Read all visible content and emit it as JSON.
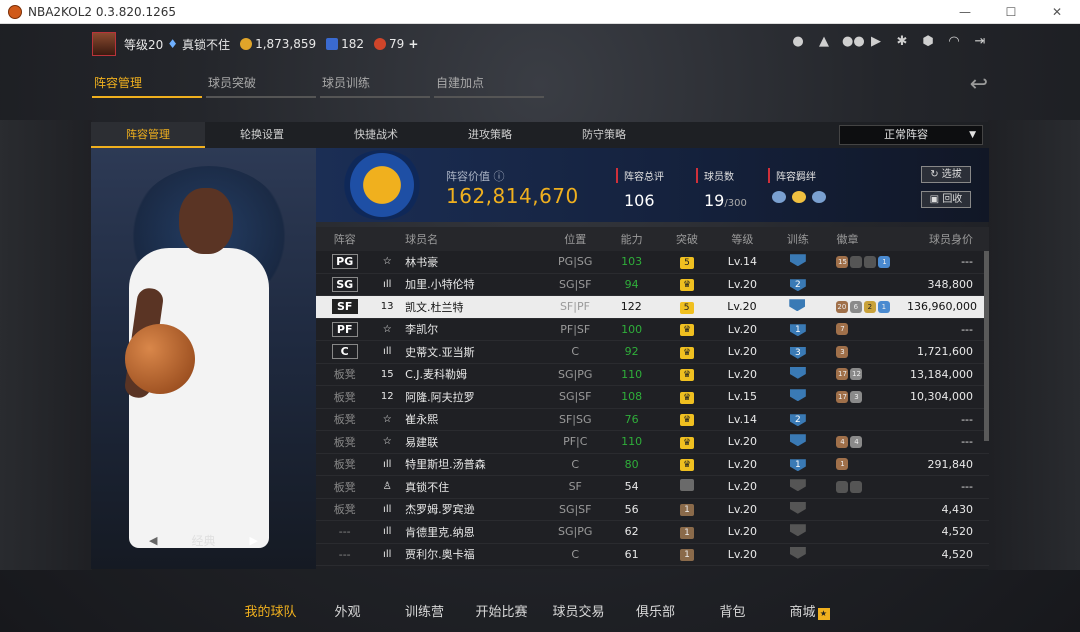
{
  "window": {
    "title": "NBA2KOL2 0.3.820.1265",
    "min_glyph": "—",
    "max_glyph": "☐",
    "close_glyph": "✕"
  },
  "user": {
    "level": "等级20",
    "name": "真锁不住",
    "coins": "1,873,859",
    "stars": "182",
    "points": "79",
    "add_glyph": "+"
  },
  "top_icons": [
    "person-icon",
    "bell-icon",
    "friends-icon",
    "video-icon",
    "gear-icon",
    "shield-icon",
    "headset-icon",
    "exit-icon"
  ],
  "main_tabs": [
    {
      "label": "阵容管理",
      "active": true
    },
    {
      "label": "球员突破",
      "active": false
    },
    {
      "label": "球员训练",
      "active": false
    },
    {
      "label": "自建加点",
      "active": false
    }
  ],
  "sub_tabs": [
    {
      "label": "阵容管理",
      "active": true
    },
    {
      "label": "轮换设置",
      "active": false
    },
    {
      "label": "快捷战术",
      "active": false
    },
    {
      "label": "进攻策略",
      "active": false
    },
    {
      "label": "防守策略",
      "active": false
    }
  ],
  "lineup_select": "正常阵容",
  "player_style": "经典",
  "team": {
    "value_label": "阵容价值",
    "value": "162,814,670",
    "rating_label": "阵容总评",
    "rating": "106",
    "count_label": "球员数",
    "count": "19",
    "count_max": "/300",
    "chem_label": "阵容羁绊",
    "select_btn": "选拔",
    "recycle_btn": "回收"
  },
  "table_headers": {
    "lineup": "阵容",
    "name": "球员名",
    "position": "位置",
    "ovr": "能力",
    "breakthrough": "突破",
    "level": "等级",
    "training": "训练",
    "badges": "徽章",
    "salary": "球员身价"
  },
  "rows": [
    {
      "slot": "PG",
      "bench": false,
      "icon": "☆",
      "name": "林书豪",
      "pos": "PG|SG",
      "ovr": "103",
      "green": true,
      "brk": "5",
      "brk_type": "y",
      "lv": "Lv.14",
      "tr": "",
      "tr_type": "",
      "badges": [
        {
          "t": "15",
          "c": "br"
        },
        {
          "t": "",
          "c": "dk"
        },
        {
          "t": "",
          "c": "dk"
        },
        {
          "t": "1",
          "c": "bl"
        }
      ],
      "sal": "---"
    },
    {
      "slot": "SG",
      "bench": false,
      "icon": "ıll",
      "name": "加里.小特伦特",
      "pos": "SG|SF",
      "ovr": "94",
      "green": true,
      "brk": "♛",
      "brk_type": "y",
      "lv": "Lv.20",
      "tr": "2",
      "tr_type": "",
      "badges": [],
      "sal": "348,800"
    },
    {
      "slot": "SF",
      "bench": false,
      "hl": true,
      "icon": "13",
      "name": "凯文.杜兰特",
      "pos": "SF|PF",
      "ovr": "122",
      "green": false,
      "brk": "5",
      "brk_type": "y",
      "lv": "Lv.20",
      "tr": "",
      "tr_type": "",
      "badges": [
        {
          "t": "20",
          "c": "br"
        },
        {
          "t": "6",
          "c": "gr"
        },
        {
          "t": "2",
          "c": "go"
        },
        {
          "t": "1",
          "c": "bl"
        }
      ],
      "sal": "136,960,000"
    },
    {
      "slot": "PF",
      "bench": false,
      "icon": "☆",
      "name": "李凯尔",
      "pos": "PF|SF",
      "ovr": "100",
      "green": true,
      "brk": "♛",
      "brk_type": "y",
      "lv": "Lv.20",
      "tr": "1",
      "tr_type": "",
      "badges": [
        {
          "t": "7",
          "c": "br"
        }
      ],
      "sal": "---"
    },
    {
      "slot": "C",
      "bench": false,
      "icon": "ıll",
      "name": "史蒂文.亚当斯",
      "pos": "C",
      "ovr": "92",
      "green": true,
      "brk": "♛",
      "brk_type": "y",
      "lv": "Lv.20",
      "tr": "3",
      "tr_type": "",
      "badges": [
        {
          "t": "3",
          "c": "br"
        }
      ],
      "sal": "1,721,600"
    },
    {
      "slot": "板凳",
      "bench": true,
      "icon": "15",
      "name": "C.J.麦科勒姆",
      "pos": "SG|PG",
      "ovr": "110",
      "green": true,
      "brk": "♛",
      "brk_type": "y",
      "lv": "Lv.20",
      "tr": "",
      "tr_type": "",
      "badges": [
        {
          "t": "17",
          "c": "br"
        },
        {
          "t": "12",
          "c": "gr"
        }
      ],
      "sal": "13,184,000"
    },
    {
      "slot": "板凳",
      "bench": true,
      "icon": "12",
      "name": "阿隆.阿夫拉罗",
      "pos": "SG|SF",
      "ovr": "108",
      "green": true,
      "brk": "♛",
      "brk_type": "y",
      "lv": "Lv.15",
      "tr": "",
      "tr_type": "",
      "badges": [
        {
          "t": "17",
          "c": "br"
        },
        {
          "t": "3",
          "c": "gr"
        }
      ],
      "sal": "10,304,000"
    },
    {
      "slot": "板凳",
      "bench": true,
      "icon": "☆",
      "name": "崔永熙",
      "pos": "SF|SG",
      "ovr": "76",
      "green": true,
      "brk": "♛",
      "brk_type": "y",
      "lv": "Lv.14",
      "tr": "2",
      "tr_type": "",
      "badges": [],
      "sal": "---"
    },
    {
      "slot": "板凳",
      "bench": true,
      "icon": "☆",
      "name": "易建联",
      "pos": "PF|C",
      "ovr": "110",
      "green": true,
      "brk": "♛",
      "brk_type": "y",
      "lv": "Lv.20",
      "tr": "",
      "tr_type": "",
      "badges": [
        {
          "t": "4",
          "c": "br"
        },
        {
          "t": "4",
          "c": "gr"
        }
      ],
      "sal": "---"
    },
    {
      "slot": "板凳",
      "bench": true,
      "icon": "ıll",
      "name": "特里斯坦.汤普森",
      "pos": "C",
      "ovr": "80",
      "green": true,
      "brk": "♛",
      "brk_type": "y",
      "lv": "Lv.20",
      "tr": "1",
      "tr_type": "",
      "badges": [
        {
          "t": "1",
          "c": "br"
        }
      ],
      "sal": "291,840"
    },
    {
      "slot": "板凳",
      "bench": true,
      "icon": "♙",
      "name": "真锁不住",
      "pos": "SF",
      "ovr": "54",
      "green": false,
      "brk": "",
      "brk_type": "g",
      "lv": "Lv.20",
      "tr": "",
      "tr_type": "g",
      "badges": [
        {
          "t": "",
          "c": "dk"
        },
        {
          "t": "",
          "c": "dk"
        }
      ],
      "sal": "---"
    },
    {
      "slot": "板凳",
      "bench": true,
      "icon": "ıll",
      "name": "杰罗姆.罗宾逊",
      "pos": "SG|SF",
      "ovr": "56",
      "green": false,
      "brk": "1",
      "brk_type": "b",
      "lv": "Lv.20",
      "tr": "",
      "tr_type": "g",
      "badges": [],
      "sal": "4,430"
    },
    {
      "slot": "---",
      "bench": true,
      "icon": "ıll",
      "name": "肯德里克.纳恩",
      "pos": "SG|PG",
      "ovr": "62",
      "green": false,
      "brk": "1",
      "brk_type": "b",
      "lv": "Lv.20",
      "tr": "",
      "tr_type": "g",
      "badges": [],
      "sal": "4,520"
    },
    {
      "slot": "---",
      "bench": true,
      "icon": "ıll",
      "name": "贾利尔.奥卡福",
      "pos": "C",
      "ovr": "61",
      "green": false,
      "brk": "1",
      "brk_type": "b",
      "lv": "Lv.20",
      "tr": "",
      "tr_type": "g",
      "badges": [],
      "sal": "4,520"
    }
  ],
  "bottom_nav": [
    {
      "label": "我的球队",
      "active": true
    },
    {
      "label": "外观",
      "active": false
    },
    {
      "label": "训练营",
      "active": false
    },
    {
      "label": "开始比赛",
      "active": false
    },
    {
      "label": "球员交易",
      "active": false
    },
    {
      "label": "俱乐部",
      "active": false
    },
    {
      "label": "背包",
      "active": false
    },
    {
      "label": "商城",
      "active": false
    }
  ]
}
